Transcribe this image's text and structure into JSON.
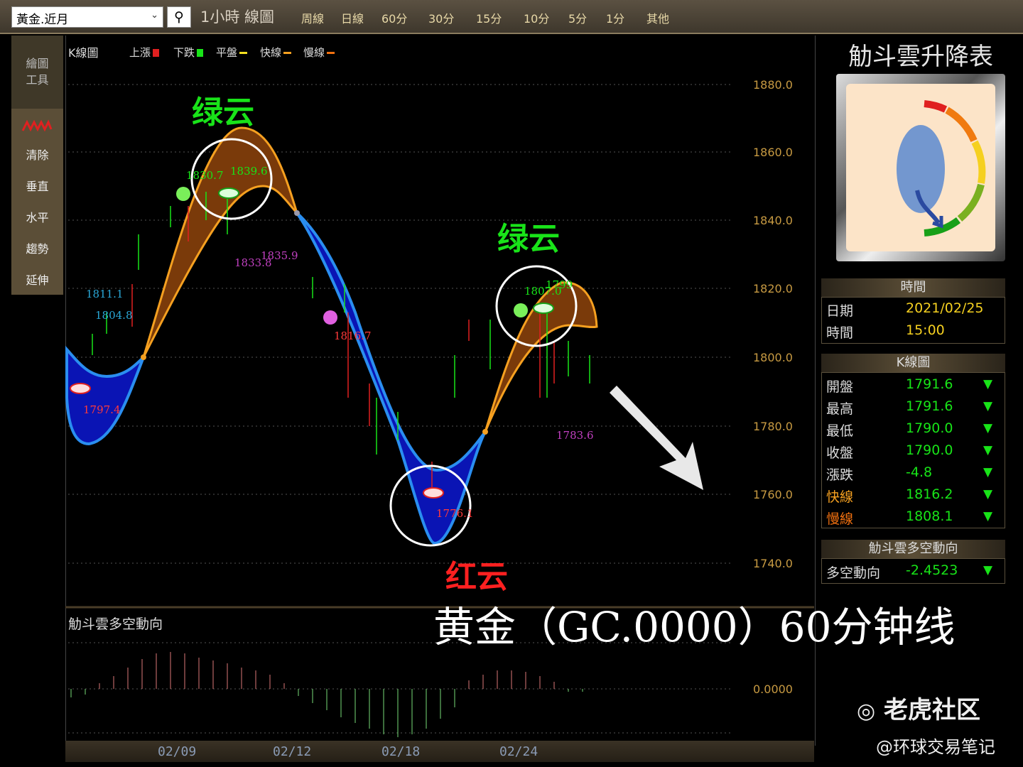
{
  "toolbar": {
    "symbol": "黃金.近月",
    "search_icon": "search-icon",
    "period_title": "1小時 線圖",
    "timeframes": [
      "周線",
      "日線",
      "60分",
      "30分",
      "15分",
      "10分",
      "5分",
      "1分",
      "其他"
    ]
  },
  "left_tools": {
    "title_line1": "繪圖",
    "title_line2": "工具",
    "items": [
      "清除",
      "垂直",
      "水平",
      "趨勢",
      "延伸"
    ]
  },
  "chart": {
    "k_label": "K線圖",
    "legend": [
      "上漲",
      "下跌",
      "平盤",
      "快線",
      "慢線"
    ],
    "y_ticks": [
      "1880.0",
      "1860.0",
      "1840.0",
      "1820.0",
      "1800.0",
      "1780.0",
      "1760.0",
      "1740.0"
    ],
    "sub_title": "觔斗雲多空動向",
    "sub_y_tick": "0.0000",
    "x_ticks": [
      "02/09",
      "02/12",
      "02/18",
      "02/24"
    ],
    "price_labels": [
      "1811.1",
      "1804.8",
      "1797.4",
      "1830.7",
      "1839.6",
      "1833.8",
      "1835.9",
      "1816.7",
      "1776.1",
      "1807.0",
      "1799",
      "1783.6"
    ],
    "annotations": {
      "green1": "绿云",
      "green2": "绿云",
      "red": "红云"
    },
    "caption": "黄金（GC.0000）60分钟线"
  },
  "chart_data": {
    "type": "line",
    "title": "黄金（GC.0000）60分钟线",
    "xlabel": "",
    "ylabel": "",
    "ylim": [
      1735,
      1885
    ],
    "x_ticks": [
      "02/09",
      "02/12",
      "02/18",
      "02/24"
    ],
    "series": [
      {
        "name": "快線",
        "values": [
          1800,
          1798,
          1812,
          1836,
          1866,
          1860,
          1838,
          1808,
          1779,
          1764,
          1778,
          1806,
          1822,
          1818
        ]
      },
      {
        "name": "慢線",
        "values": [
          1806,
          1788,
          1804,
          1826,
          1848,
          1848,
          1832,
          1806,
          1778,
          1748,
          1778,
          1800,
          1809,
          1808
        ]
      }
    ],
    "sub_series": {
      "name": "觔斗雲多空動向",
      "zero_line": 0.0
    }
  },
  "right_panel": {
    "title": "觔斗雲升降表",
    "time_header": "時間",
    "date_label": "日期",
    "date_value": "2021/02/25",
    "time_label": "時間",
    "time_value": "15:00",
    "k_header": "K線圖",
    "k_rows": [
      {
        "label": "開盤",
        "value": "1791.6",
        "arrow": "▼"
      },
      {
        "label": "最高",
        "value": "1791.6",
        "arrow": "▼"
      },
      {
        "label": "最低",
        "value": "1790.0",
        "arrow": "▼"
      },
      {
        "label": "收盤",
        "value": "1790.0",
        "arrow": "▼"
      },
      {
        "label": "漲跌",
        "value": "-4.8",
        "arrow": "▼"
      },
      {
        "label": "快線",
        "value": "1816.2",
        "arrow": "▼"
      },
      {
        "label": "慢線",
        "value": "1808.1",
        "arrow": "▼"
      }
    ],
    "trend_header": "觔斗雲多空動向",
    "trend_label": "多空動向",
    "trend_value": "-2.4523",
    "trend_arrow": "▼"
  },
  "watermark": {
    "brand": "老虎社区",
    "handle": "@环球交易笔记"
  },
  "colors": {
    "rise": "#e02020",
    "fall": "#18e418",
    "fast": "#f5a020",
    "slow": "#f07010",
    "cloud_green": "#7a3a0a",
    "cloud_red": "#0a14b4"
  }
}
